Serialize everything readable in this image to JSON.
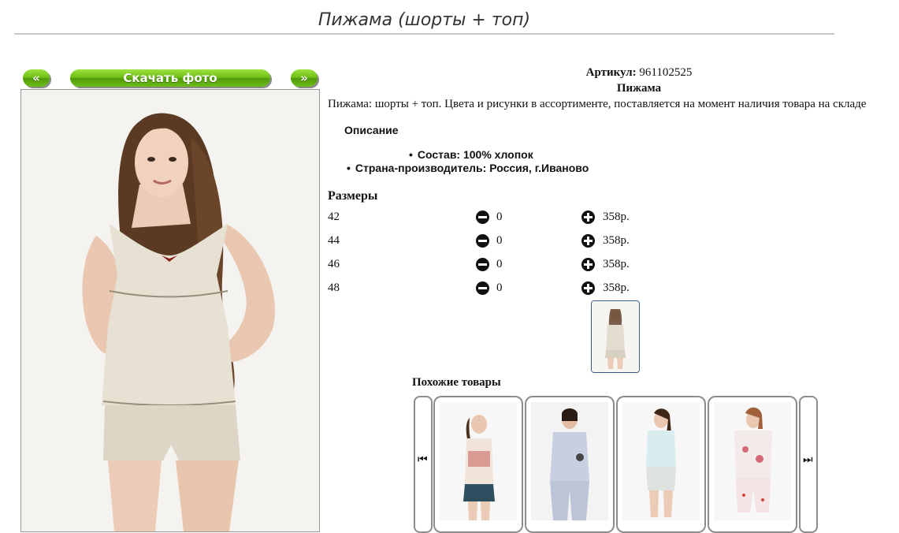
{
  "page": {
    "title": "Пижама (шорты + топ)"
  },
  "gallery": {
    "prev_label": "«",
    "download_label": "Скачать фото",
    "next_label": "»"
  },
  "product": {
    "article_label": "Артикул:",
    "article_value": "961102525",
    "name": "Пижама",
    "description": "Пижама: шорты + топ. Цвета и рисунки в ассортименте, поставляется на момент наличия товара на складе",
    "specs_heading": "Описание",
    "specs": [
      "Состав: 100% хлопок",
      "Страна-производитель: Россия, г.Иваново"
    ]
  },
  "sizes": {
    "heading": "Размеры",
    "rows": [
      {
        "size": "42",
        "qty": "0",
        "price": "358р."
      },
      {
        "size": "44",
        "qty": "0",
        "price": "358р."
      },
      {
        "size": "46",
        "qty": "0",
        "price": "358р."
      },
      {
        "size": "48",
        "qty": "0",
        "price": "358р."
      }
    ]
  },
  "similar": {
    "heading": "Похожие товары",
    "prev_icon": "skip-back-icon",
    "next_icon": "skip-forward-icon"
  },
  "colors": {
    "button_green": "#6cbc14",
    "thumb_border": "#3b5b8a"
  }
}
